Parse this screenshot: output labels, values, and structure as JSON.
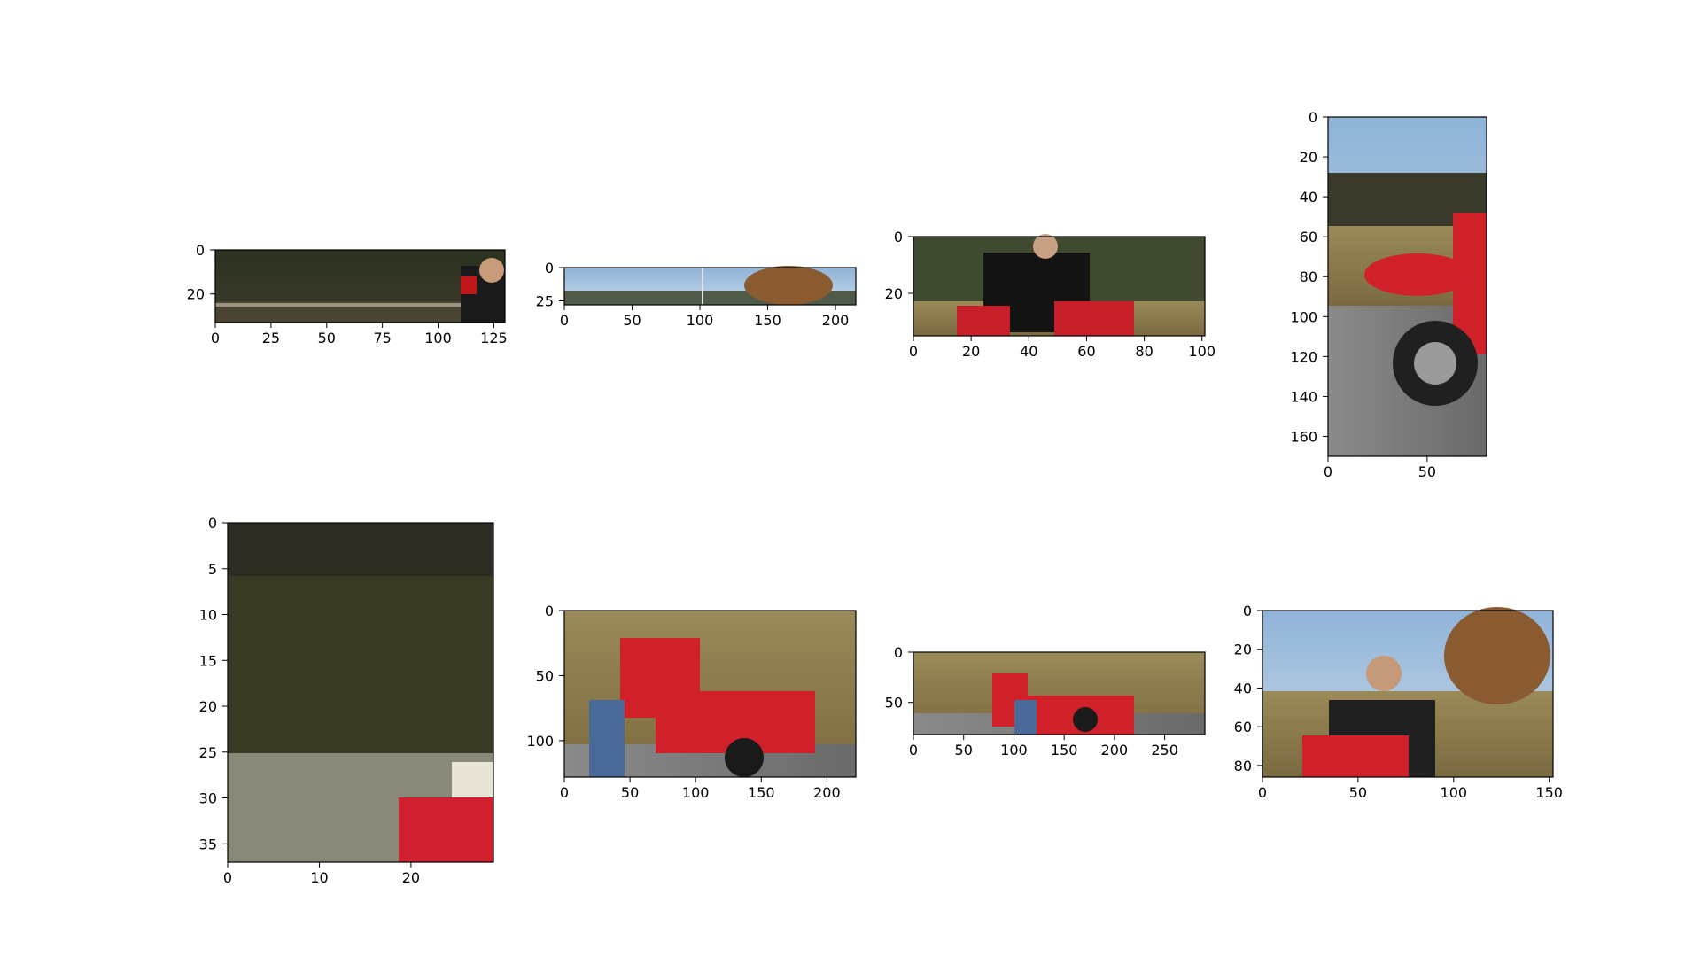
{
  "figure": {
    "background": "#ffffff",
    "panels": [
      {
        "id": "p1",
        "description_colors": [
          "#2f3a24",
          "#4a4a38",
          "#8a7a5a",
          "#c01818"
        ],
        "x_range": [
          0,
          130
        ],
        "y_range": [
          33,
          0
        ],
        "x_ticks": [
          0,
          25,
          50,
          75,
          100,
          125
        ],
        "y_ticks": [
          0,
          20
        ],
        "x_tick_labels": [
          "0",
          "25",
          "50",
          "75",
          "100",
          "125"
        ],
        "y_tick_labels": [
          "0",
          "20"
        ]
      },
      {
        "id": "p2",
        "description_colors": [
          "#8fb4d8",
          "#4f6f86",
          "#8a5a30",
          "#3a3a2a"
        ],
        "x_range": [
          0,
          215
        ],
        "y_range": [
          28,
          0
        ],
        "x_ticks": [
          0,
          50,
          100,
          150,
          200
        ],
        "y_ticks": [
          0,
          25
        ],
        "x_tick_labels": [
          "0",
          "50",
          "100",
          "150",
          "200"
        ],
        "y_tick_labels": [
          "0",
          "25"
        ]
      },
      {
        "id": "p3",
        "description_colors": [
          "#3f4a30",
          "#141414",
          "#c8202a",
          "#a08a50"
        ],
        "x_range": [
          0,
          101
        ],
        "y_range": [
          35,
          0
        ],
        "x_ticks": [
          0,
          20,
          40,
          60,
          80,
          100
        ],
        "y_ticks": [
          0,
          20
        ],
        "x_tick_labels": [
          "0",
          "20",
          "40",
          "60",
          "80",
          "100"
        ],
        "y_tick_labels": [
          "0",
          "20"
        ]
      },
      {
        "id": "p4",
        "description_colors": [
          "#9ab2c8",
          "#3a3a2a",
          "#a08a50",
          "#d0202a",
          "#8a8a8a"
        ],
        "x_range": [
          0,
          80
        ],
        "y_range": [
          170,
          0
        ],
        "x_ticks": [
          0,
          50
        ],
        "y_ticks": [
          0,
          20,
          40,
          60,
          80,
          100,
          120,
          140,
          160
        ],
        "x_tick_labels": [
          "0",
          "50"
        ],
        "y_tick_labels": [
          "0",
          "20",
          "40",
          "60",
          "80",
          "100",
          "120",
          "140",
          "160"
        ]
      },
      {
        "id": "p5",
        "description_colors": [
          "#2e2c22",
          "#3a3a24",
          "#8a8878",
          "#d02030",
          "#e8e4d8"
        ],
        "x_range": [
          0,
          29
        ],
        "y_range": [
          37,
          0
        ],
        "x_ticks": [
          0,
          10,
          20
        ],
        "y_ticks": [
          0,
          5,
          10,
          15,
          20,
          25,
          30,
          35
        ],
        "x_tick_labels": [
          "0",
          "10",
          "20"
        ],
        "y_tick_labels": [
          "0",
          "5",
          "10",
          "15",
          "20",
          "25",
          "30",
          "35"
        ]
      },
      {
        "id": "p6",
        "description_colors": [
          "#a89460",
          "#d0202a",
          "#141414",
          "#4a6a9a",
          "#707070"
        ],
        "x_range": [
          0,
          222
        ],
        "y_range": [
          128,
          0
        ],
        "x_ticks": [
          0,
          50,
          100,
          150,
          200
        ],
        "y_ticks": [
          0,
          50,
          100
        ],
        "x_tick_labels": [
          "0",
          "50",
          "100",
          "150",
          "200"
        ],
        "y_tick_labels": [
          "0",
          "50",
          "100"
        ]
      },
      {
        "id": "p7",
        "description_colors": [
          "#a08a50",
          "#d0202a",
          "#141414",
          "#4a6a9a",
          "#7a7a7a"
        ],
        "x_range": [
          0,
          290
        ],
        "y_range": [
          82,
          0
        ],
        "x_ticks": [
          0,
          50,
          100,
          150,
          200,
          250
        ],
        "y_ticks": [
          0,
          50
        ],
        "x_tick_labels": [
          "0",
          "50",
          "100",
          "150",
          "200",
          "250"
        ],
        "y_tick_labels": [
          "0",
          "50"
        ]
      },
      {
        "id": "p8",
        "description_colors": [
          "#9ab8d8",
          "#8a5a30",
          "#2a2a2a",
          "#d0202a",
          "#a08a50"
        ],
        "x_range": [
          0,
          152
        ],
        "y_range": [
          86,
          0
        ],
        "x_ticks": [
          0,
          50,
          100,
          150
        ],
        "y_ticks": [
          0,
          20,
          40,
          60,
          80
        ],
        "x_tick_labels": [
          "0",
          "50",
          "100",
          "150"
        ],
        "y_tick_labels": [
          "0",
          "20",
          "40",
          "60",
          "80"
        ]
      }
    ]
  }
}
